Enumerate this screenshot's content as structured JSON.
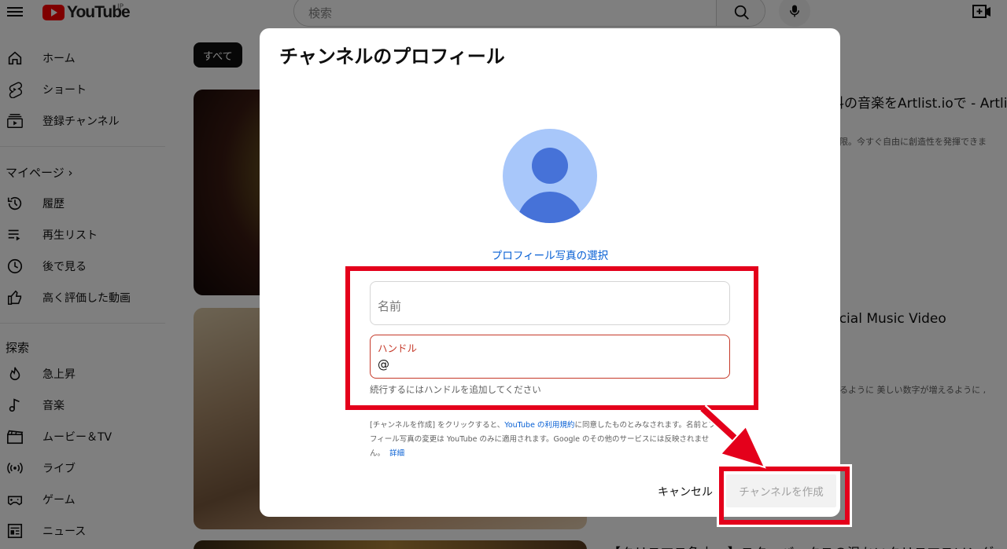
{
  "header": {
    "logo_text": "YouTube",
    "region": "JP",
    "search_placeholder": "検索"
  },
  "sidebar": {
    "main": [
      {
        "label": "ホーム",
        "icon": "home-icon"
      },
      {
        "label": "ショート",
        "icon": "shorts-icon"
      },
      {
        "label": "登録チャンネル",
        "icon": "subscriptions-icon"
      }
    ],
    "mypage_heading": "マイページ",
    "mypage": [
      {
        "label": "履歴",
        "icon": "history-icon"
      },
      {
        "label": "再生リスト",
        "icon": "playlist-icon"
      },
      {
        "label": "後で見る",
        "icon": "clock-icon"
      },
      {
        "label": "高く評価した動画",
        "icon": "thumbs-up-icon"
      }
    ],
    "explore_heading": "探索",
    "explore": [
      {
        "label": "急上昇",
        "icon": "trending-icon"
      },
      {
        "label": "音楽",
        "icon": "music-icon"
      },
      {
        "label": "ムービー＆TV",
        "icon": "movie-icon"
      },
      {
        "label": "ライブ",
        "icon": "live-icon"
      },
      {
        "label": "ゲーム",
        "icon": "gaming-icon"
      },
      {
        "label": "ニュース",
        "icon": "news-icon"
      }
    ]
  },
  "main": {
    "chip_all": "すべて",
    "video1_title": "料の音楽をArtlist.ioで - Artli",
    "video1_sub": "制限。今すぐ自由に創造性を発揮できま",
    "video2_title": "ficial Music Video",
    "video2_sub": "減るように 美しい数字が増えるように ,",
    "video3_title": "【クリスマス急上　】スターバックスの温かいクリスマスソング"
  },
  "dialog": {
    "title": "チャンネルのプロフィール",
    "pick_photo": "プロフィール写真の選択",
    "name_placeholder": "名前",
    "handle_label": "ハンドル",
    "handle_prefix": "@",
    "handle_hint": "続行するにはハンドルを追加してください",
    "terms_1": "[チャンネルを作成] をクリックすると、",
    "terms_link": "YouTube の利用規約",
    "terms_2": "に同意したものとみなされます。名前とプロフィール写真の変更は YouTube のみに適用されます。Google のその他のサービスには反映されません。",
    "details_link": "詳細",
    "cancel_label": "キャンセル",
    "create_label": "チャンネルを作成"
  },
  "colors": {
    "annotation_red": "#e4001b",
    "link_blue": "#065fd4",
    "error_red": "#c53929"
  }
}
